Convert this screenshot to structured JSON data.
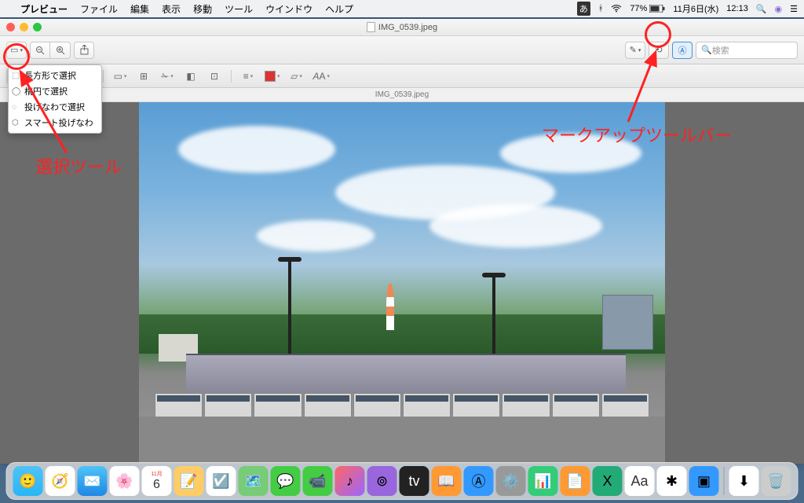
{
  "menubar": {
    "app": "プレビュー",
    "items": [
      "ファイル",
      "編集",
      "表示",
      "移動",
      "ツール",
      "ウインドウ",
      "ヘルプ"
    ],
    "right": {
      "ime": "あ",
      "battery": "77%",
      "date": "11月6日(水)",
      "time": "12:13"
    }
  },
  "window": {
    "title": "IMG_0539.jpeg",
    "subtitle": "IMG_0539.jpeg",
    "search_placeholder": "検索"
  },
  "selection_menu": {
    "items": [
      "長方形で選択",
      "楕円で選択",
      "投げなわで選択",
      "スマート投げなわ"
    ]
  },
  "annotations": {
    "selection_tool": "選択ツール",
    "markup_toolbar": "マークアップツールバー"
  },
  "dock": {
    "cal_month": "11月",
    "cal_day": "6"
  }
}
